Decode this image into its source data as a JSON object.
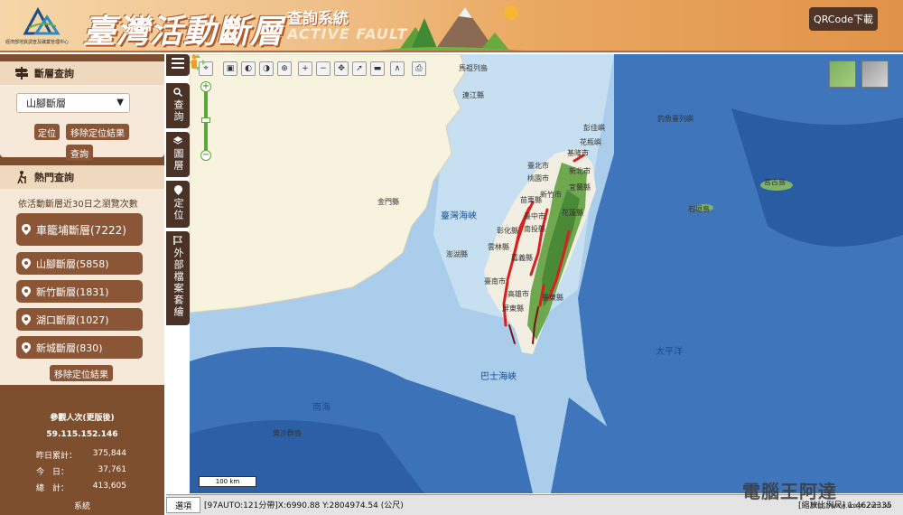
{
  "header": {
    "logo_caption": "經濟部地質調查及礦業管理中心",
    "title": "臺灣活動斷層",
    "subtitle_zh": "查詢系統",
    "subtitle_en": "ACTIVE FAULT",
    "qr_button": "QRCode下載"
  },
  "sidebar": {
    "fault_query": {
      "title": "斷層查詢",
      "selected_fault": "山腳斷層",
      "locate_btn": "定位",
      "remove_btn": "移除定位結果",
      "query_btn": "查詢"
    },
    "hot_query": {
      "title": "熱門查詢",
      "description": "依活動斷層近30日之瀏覽次數",
      "items": [
        {
          "label": "車籠埔斷層(7222)"
        },
        {
          "label": "山腳斷層(5858)"
        },
        {
          "label": "新竹斷層(1831)"
        },
        {
          "label": "湖口斷層(1027)"
        },
        {
          "label": "新城斷層(830)"
        }
      ],
      "remove_btn": "移除定位結果"
    },
    "stats": {
      "visitors_label": "參觀人次(更版後)",
      "visitors_value": "59.115.152.146",
      "rows": [
        {
          "label": "昨日累計：",
          "value": "375,844"
        },
        {
          "label": "今　日：",
          "value": "37,761"
        },
        {
          "label": "總　計：",
          "value": "413,605"
        }
      ],
      "footer": "系統"
    }
  },
  "tabs": [
    {
      "label": "查詢",
      "icon": "search-icon"
    },
    {
      "label": "圖層",
      "icon": "layers-icon"
    },
    {
      "label": "定位",
      "icon": "location-pin-icon"
    },
    {
      "label": "外部檔案套繪",
      "icon": "flag-icon"
    }
  ],
  "map": {
    "places": [
      {
        "name": "馬祖列島",
        "kind": "place"
      },
      {
        "name": "連江縣",
        "kind": "place"
      },
      {
        "name": "金門縣",
        "kind": "place"
      },
      {
        "name": "澎湖縣",
        "kind": "place"
      },
      {
        "name": "基隆市",
        "kind": "place"
      },
      {
        "name": "臺北市",
        "kind": "place"
      },
      {
        "name": "新北市",
        "kind": "place"
      },
      {
        "name": "桃園市",
        "kind": "place"
      },
      {
        "name": "新竹市",
        "kind": "place"
      },
      {
        "name": "宜蘭縣",
        "kind": "place"
      },
      {
        "name": "苗栗縣",
        "kind": "place"
      },
      {
        "name": "臺中市",
        "kind": "place"
      },
      {
        "name": "花蓮縣",
        "kind": "place"
      },
      {
        "name": "彰化縣",
        "kind": "place"
      },
      {
        "name": "南投縣",
        "kind": "place"
      },
      {
        "name": "雲林縣",
        "kind": "place"
      },
      {
        "name": "嘉義縣",
        "kind": "place"
      },
      {
        "name": "臺南市",
        "kind": "place"
      },
      {
        "name": "高雄市",
        "kind": "place"
      },
      {
        "name": "臺東縣",
        "kind": "place"
      },
      {
        "name": "屏東縣",
        "kind": "place"
      },
      {
        "name": "彭佳嶼",
        "kind": "place"
      },
      {
        "name": "釣魚臺列嶼",
        "kind": "place"
      },
      {
        "name": "花瓶嶼",
        "kind": "place"
      },
      {
        "name": "宮古島",
        "kind": "place"
      },
      {
        "name": "石垣島",
        "kind": "place"
      },
      {
        "name": "東沙群島",
        "kind": "place"
      },
      {
        "name": "臺灣海峽",
        "kind": "sea"
      },
      {
        "name": "巴士海峽",
        "kind": "sea"
      },
      {
        "name": "南海",
        "kind": "sea"
      },
      {
        "name": "太平洋",
        "kind": "sea"
      }
    ],
    "scale_label": "100 km",
    "zoom_in": "+",
    "zoom_out": "−"
  },
  "statusbar": {
    "options_btn": "選項",
    "coordinates": "[97AUTO:121分帶]X:6990.88 Y:2804974.54 (公尺)",
    "scale_text": "[縮放比例尺] 1:4622335"
  },
  "watermark": {
    "text": "電腦王阿達",
    "url": "http://www.kocpc.com.tw"
  },
  "colors": {
    "header_bg": "#efc089",
    "sidebar_bg": "#7e4f2e",
    "button_brown": "#8a5636",
    "fault_line": "#d92020",
    "sea": "#9fc6e7"
  }
}
